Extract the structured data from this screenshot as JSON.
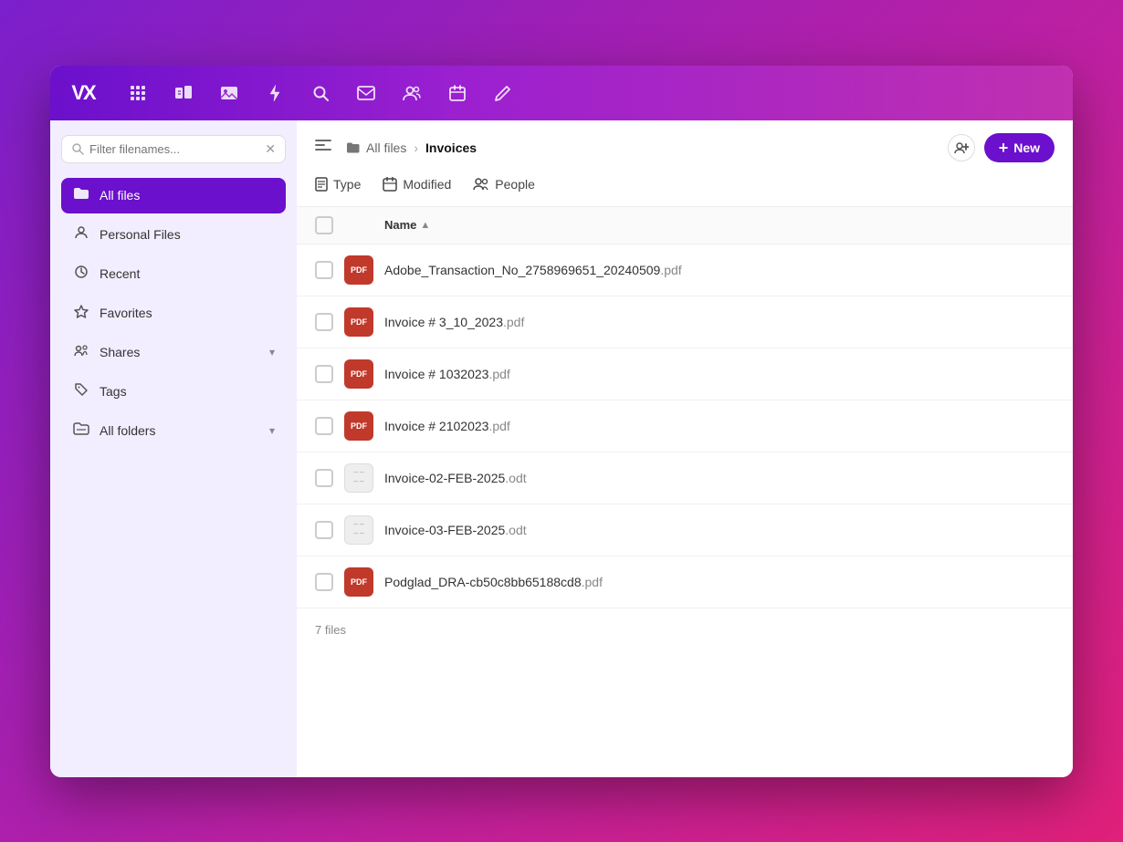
{
  "topbar": {
    "logo_text": "VX",
    "icons": [
      {
        "name": "grid-icon",
        "symbol": "⊞"
      },
      {
        "name": "files-icon",
        "symbol": "🗂"
      },
      {
        "name": "photos-icon",
        "symbol": "🖼"
      },
      {
        "name": "bolt-icon",
        "symbol": "⚡"
      },
      {
        "name": "search-icon",
        "symbol": "🔍"
      },
      {
        "name": "mail-icon",
        "symbol": "✉"
      },
      {
        "name": "people-icon",
        "symbol": "👥"
      },
      {
        "name": "calendar-icon",
        "symbol": "📅"
      },
      {
        "name": "edit-icon",
        "symbol": "✏"
      }
    ]
  },
  "sidebar": {
    "search_placeholder": "Filter filenames...",
    "items": [
      {
        "id": "all-files",
        "label": "All files",
        "icon": "📁",
        "active": true
      },
      {
        "id": "personal-files",
        "label": "Personal Files",
        "icon": "👤",
        "active": false
      },
      {
        "id": "recent",
        "label": "Recent",
        "icon": "🕒",
        "active": false
      },
      {
        "id": "favorites",
        "label": "Favorites",
        "icon": "⭐",
        "active": false
      },
      {
        "id": "shares",
        "label": "Shares",
        "icon": "👥",
        "active": false,
        "hasChevron": true
      },
      {
        "id": "tags",
        "label": "Tags",
        "icon": "🏷",
        "active": false
      },
      {
        "id": "all-folders",
        "label": "All folders",
        "icon": "📂",
        "active": false,
        "hasChevron": true
      }
    ]
  },
  "breadcrumb": {
    "parent_label": "All files",
    "parent_icon": "📁",
    "separator": "›",
    "current_label": "Invoices"
  },
  "toolbar": {
    "add_people_icon": "+👤",
    "new_button_label": "New",
    "new_button_icon": "+"
  },
  "filters": {
    "type_label": "Type",
    "type_icon": "📄",
    "modified_label": "Modified",
    "modified_icon": "📅",
    "people_label": "People",
    "people_icon": "👥"
  },
  "column_headers": {
    "name_label": "Name",
    "sort_indicator": "▲"
  },
  "files": [
    {
      "id": 1,
      "name": "Adobe_Transaction_No_2758969651_20240509",
      "ext": ".pdf",
      "type": "pdf"
    },
    {
      "id": 2,
      "name": "Invoice # 3_10_2023",
      "ext": ".pdf",
      "type": "pdf"
    },
    {
      "id": 3,
      "name": "Invoice # 1032023",
      "ext": ".pdf",
      "type": "pdf"
    },
    {
      "id": 4,
      "name": "Invoice # 2102023",
      "ext": ".pdf",
      "type": "pdf"
    },
    {
      "id": 5,
      "name": "Invoice-02-FEB-2025",
      "ext": ".odt",
      "type": "odt"
    },
    {
      "id": 6,
      "name": "Invoice-03-FEB-2025",
      "ext": ".odt",
      "type": "odt"
    },
    {
      "id": 7,
      "name": "Podglad_DRA-cb50c8bb65188cd8",
      "ext": ".pdf",
      "type": "pdf"
    }
  ],
  "file_count_label": "7 files",
  "collapse_icon": "☰"
}
